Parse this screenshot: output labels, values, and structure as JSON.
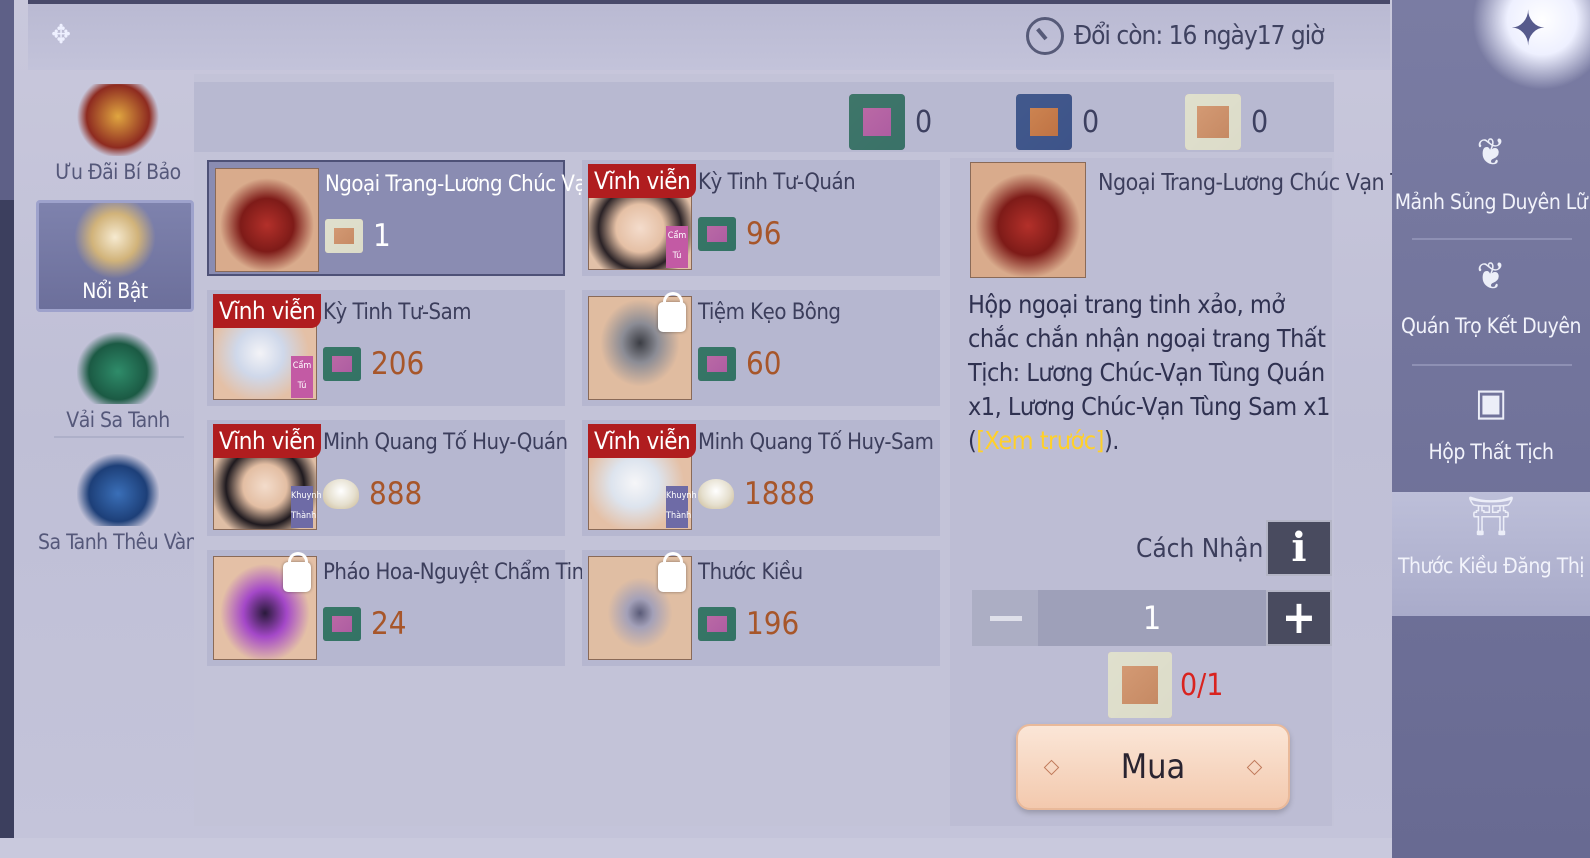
{
  "timer": {
    "text": "Đổi còn: 16 ngày17 giờ"
  },
  "currencies": [
    {
      "icon": "green-satin-icon",
      "value": "0"
    },
    {
      "icon": "gold-embroidered-satin-icon",
      "value": "0"
    },
    {
      "icon": "outfit-icon",
      "value": "0"
    }
  ],
  "sidebar": {
    "items": [
      {
        "label": "Ưu Đãi Bí Bảo"
      },
      {
        "label": "Nổi Bật"
      },
      {
        "label": "Vải Sa Tanh"
      },
      {
        "label": "Sa Tanh Thêu Vàng"
      }
    ]
  },
  "items": [
    {
      "name": "Ngoại Trang-Lương Chúc Vạn Tùng",
      "price": "1",
      "badge": "",
      "tag": ""
    },
    {
      "name": "Kỳ Tinh Tư-Quán",
      "price": "96",
      "badge": "Vĩnh viễn",
      "tag": "Cẩm Tú"
    },
    {
      "name": "Kỳ Tinh Tư-Sam",
      "price": "206",
      "badge": "Vĩnh viễn",
      "tag": "Cẩm Tú"
    },
    {
      "name": "Tiệm Kẹo Bông",
      "price": "60",
      "badge": "",
      "tag": ""
    },
    {
      "name": "Minh Quang Tố Huy-Quán",
      "price": "888",
      "badge": "Vĩnh viễn",
      "tag": "Khuynh Thành"
    },
    {
      "name": "Minh Quang Tố Huy-Sam",
      "price": "1888",
      "badge": "Vĩnh viễn",
      "tag": "Khuynh Thành"
    },
    {
      "name": "Pháo Hoa-Nguyệt Chẩm Tinh Hà",
      "price": "24",
      "badge": "",
      "tag": ""
    },
    {
      "name": "Thước Kiều",
      "price": "196",
      "badge": "",
      "tag": ""
    }
  ],
  "detail": {
    "title": "Ngoại Trang-Lương Chúc Vạn Tùng",
    "desc_pre": "Hộp ngoại trang tinh xảo, mở chắc chắn nhận ngoại trang Thất Tịch: Lương Chúc-Vạn Tùng Quán x1, Lương Chúc-Vạn Tùng Sam x1 (",
    "desc_link": "[Xem trước]",
    "desc_post": ").",
    "howto_label": "Cách Nhận",
    "info_label": "i",
    "quantity": "1",
    "requirement": "0/1",
    "buy_label": "Mua"
  },
  "right_tabs": [
    {
      "label": "Mảnh Sủng Duyên Lữ"
    },
    {
      "label": "Quán Trọ Kết Duyên"
    },
    {
      "label": "Hộp Thất Tịch"
    },
    {
      "label": "Thước Kiều Đăng Thị"
    }
  ]
}
